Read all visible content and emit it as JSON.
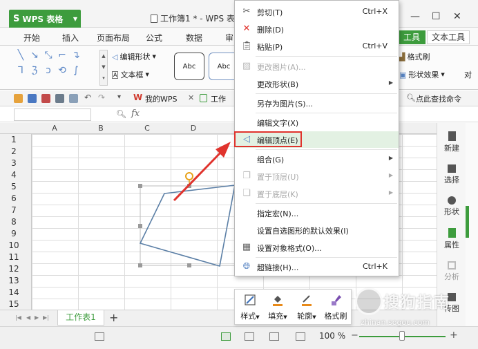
{
  "titlebar": {
    "app_name": "WPS 表格",
    "doc_title": "工作簿1 * - WPS 表",
    "minimize": "—",
    "restore": "☐",
    "close": "✕"
  },
  "ribbon_tabs": {
    "start": "开始",
    "insert": "插入",
    "layout": "页面布局",
    "formula": "公式",
    "data": "数据",
    "review": "审",
    "tools": "工具",
    "text_tools": "文本工具"
  },
  "ribbon_body": {
    "edit_shape": "编辑形状",
    "text_box": "文本框",
    "abc1": "Abc",
    "abc2": "Abc",
    "format_painter": "格式刷",
    "shape_effect": "形状效果",
    "align_hint": "对"
  },
  "quickbar": {
    "my_wps": "我的WPS",
    "workbook_tab": "工作",
    "search": "点此查找命令"
  },
  "formulabar": {
    "fx": "fx"
  },
  "sheet": {
    "columns": [
      "A",
      "B",
      "C",
      "D"
    ],
    "rows": [
      "1",
      "2",
      "3",
      "4",
      "5",
      "6",
      "7",
      "8",
      "9",
      "10",
      "11",
      "12",
      "13",
      "14",
      "15"
    ]
  },
  "sheet_tabs": {
    "tab_name": "工作表1",
    "add": "+"
  },
  "statusbar": {
    "zoom": "100 %",
    "minus": "−",
    "plus": "+"
  },
  "side_panel": {
    "new": "新建",
    "select": "选择",
    "shape": "形状",
    "property": "属性",
    "analyze": "分析",
    "transfer": "传图"
  },
  "context_menu": {
    "cut": {
      "label": "剪切(T)",
      "shortcut": "Ctrl+X"
    },
    "delete": {
      "label": "删除(D)"
    },
    "paste": {
      "label": "粘贴(P)",
      "shortcut": "Ctrl+V"
    },
    "change_picture": {
      "label": "更改图片(A)..."
    },
    "change_shape": {
      "label": "更改形状(B)"
    },
    "save_as_picture": {
      "label": "另存为图片(S)..."
    },
    "edit_text": {
      "label": "编辑文字(X)"
    },
    "edit_points": {
      "label": "编辑顶点(E)"
    },
    "group": {
      "label": "组合(G)"
    },
    "bring_to_front": {
      "label": "置于顶层(U)"
    },
    "send_to_back": {
      "label": "置于底层(K)"
    },
    "assign_macro": {
      "label": "指定宏(N)..."
    },
    "set_default_effect": {
      "label": "设置自选图形的默认效果(I)"
    },
    "format_object": {
      "label": "设置对象格式(O)..."
    },
    "hyperlink": {
      "label": "超链接(H)...",
      "shortcut": "Ctrl+K"
    }
  },
  "mini_toolbar": {
    "style": "样式",
    "fill": "填充",
    "outline": "轮廓",
    "format_painter": "格式刷"
  },
  "watermark": {
    "brand": "搜狗指南",
    "url": "zhinan.sogou.com"
  },
  "colors": {
    "accent": "#3d9c3d",
    "highlight_border": "#e0332d",
    "shape_line": "#5b7fa6"
  }
}
